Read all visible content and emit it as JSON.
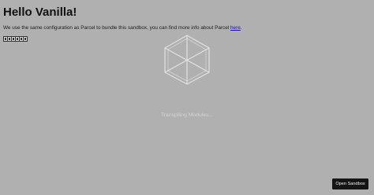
{
  "page": {
    "title": "Hello Vanilla!",
    "intro_text": "We use the same configuration as Parcel to bundle this sandbox, you can find more info about Parcel ",
    "link_text": "here",
    "link_suffix": "."
  },
  "loader": {
    "icon": "cube-icon",
    "status_text": "Transpiling Modules..."
  },
  "actions": {
    "open_sandbox_label": "Open Sandbox"
  },
  "colors": {
    "background": "#b0b0b0",
    "loader_stroke": "#e2e2e2",
    "button_bg": "#151515",
    "link": "#1a0dab"
  }
}
